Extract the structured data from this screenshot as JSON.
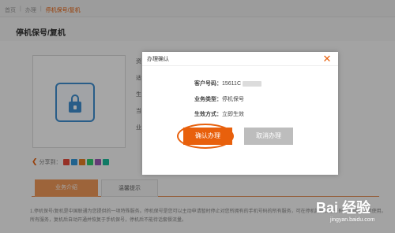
{
  "breadcrumb": {
    "items": [
      "首页",
      "办理",
      "停机保号/复机"
    ]
  },
  "page_title": "停机保号/复机",
  "side_labels": [
    "资",
    "适",
    "生",
    "当",
    "业"
  ],
  "share_label": "分享到：",
  "share_colors": [
    "#e74c3c",
    "#3498db",
    "#e67e22",
    "#2ecc71",
    "#9b59b6",
    "#1abc9c"
  ],
  "tabs": [
    "业务介绍",
    "温馨提示"
  ],
  "description": "1.停机保号/复机是中国联通为您提供的一项特殊服务。停机保号是您可以主动申请暂时停止对您所拥有的手机号码的所有服务，可在停机期间保留号码。到期后继续使用。所有服务，复机后自动开通并恢复于手机保号，停机后不能待话套餐流量。",
  "dialog": {
    "title": "办理确认",
    "close_glyph": "✕",
    "customer_label": "客户号码：",
    "customer_value": "15611C",
    "type_label": "业务类型：",
    "type_value": "停机保号",
    "effect_label": "生效方式：",
    "effect_value": "立即生效",
    "confirm_label": "确认办理",
    "cancel_label": "取消办理"
  },
  "watermark": {
    "brand": "Bai 经验",
    "url": "jingyan.baidu.com"
  },
  "colors": {
    "accent": "#e8600c",
    "lock_blue": "#3f8fd1",
    "cancel_gray": "#bdbdbd"
  },
  "icons": {
    "close": "close-icon",
    "lock": "lock-phone-icon",
    "share": "share-icon"
  }
}
